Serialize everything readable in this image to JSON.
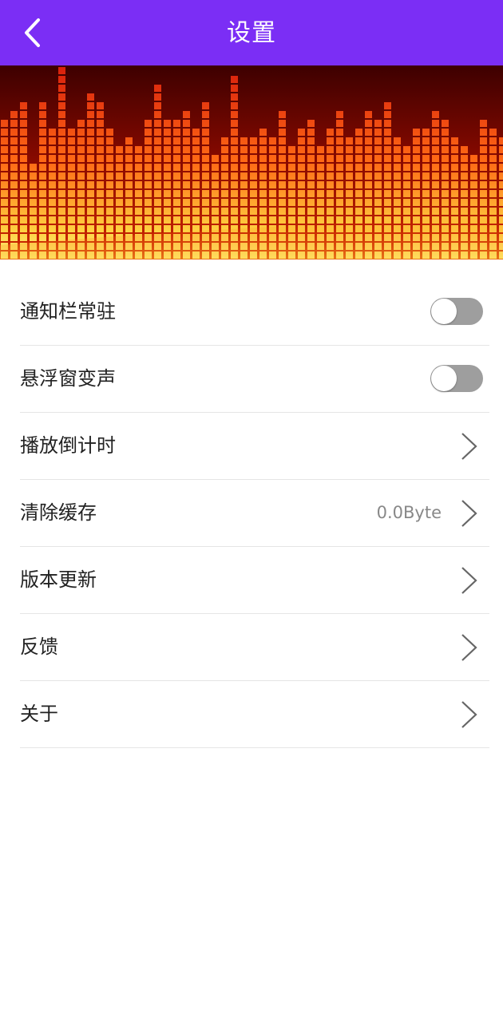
{
  "colors": {
    "header_bg": "#7B2EF5",
    "toggle_off": "#9e9e9e",
    "divider": "#e5e5e5"
  },
  "header": {
    "title": "设置",
    "back_icon": "chevron-left-icon"
  },
  "banner": {
    "image": "equalizer-banner"
  },
  "settings": {
    "notification": {
      "label": "通知栏常驻",
      "enabled": false
    },
    "floating_voice": {
      "label": "悬浮窗变声",
      "enabled": false
    },
    "timer": {
      "label": "播放倒计时"
    },
    "clear_cache": {
      "label": "清除缓存",
      "value": "0.0Byte"
    },
    "update": {
      "label": "版本更新"
    },
    "feedback": {
      "label": "反馈"
    },
    "about": {
      "label": "关于"
    }
  }
}
